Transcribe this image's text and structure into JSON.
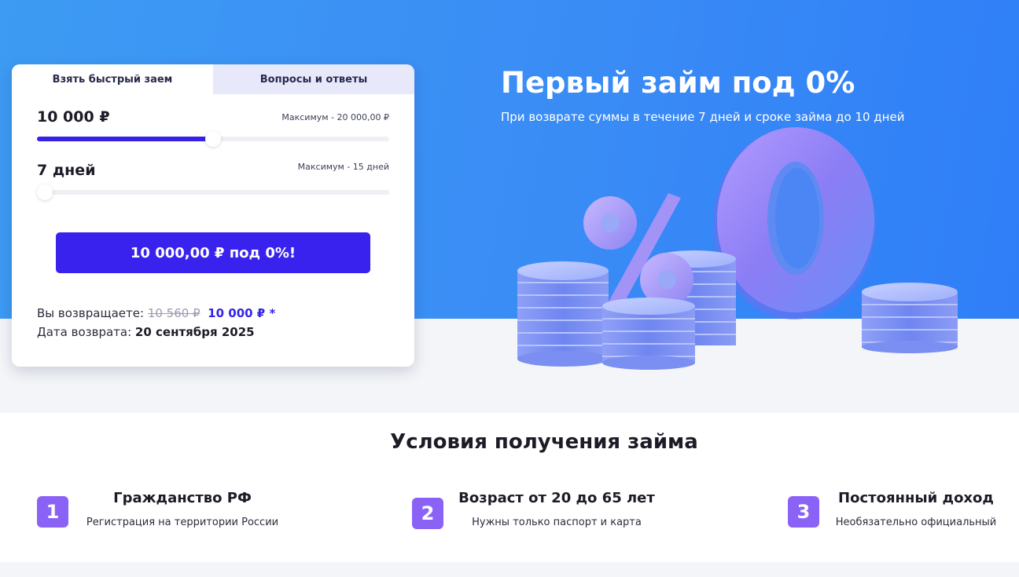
{
  "tabs": {
    "active_label": "Взять быстрый заем",
    "inactive_label": "Вопросы и ответы"
  },
  "amount": {
    "value": "10 000 ₽",
    "max_label": "Максимум - 20 000,00 ₽",
    "slider_fraction": 0.5
  },
  "term": {
    "value": "7 дней",
    "max_label": "Максимум - 15 дней",
    "slider_fraction": 0.0
  },
  "cta_label": "10 000,00 ₽ под 0%!",
  "return": {
    "label": "Вы возвращаете:",
    "old_amount": "10 560 ₽",
    "new_amount": "10 000 ₽ *",
    "date_label": "Дата возврата:",
    "date_value": "20 сентября 2025"
  },
  "hero": {
    "title": "Первый займ под 0%",
    "subtitle": "При возврате суммы в течение 7 дней и сроке займа до 10 дней",
    "illustration_text": {
      "percent": "%",
      "zero": "0"
    }
  },
  "conditions": {
    "title": "Условия получения займа",
    "items": [
      {
        "number": "1",
        "heading": "Гражданство РФ",
        "sub": "Регистрация на территории России"
      },
      {
        "number": "2",
        "heading": "Возраст от 20 до 65 лет",
        "sub": "Нужны только паспорт и карта"
      },
      {
        "number": "3",
        "heading": "Постоянный доход",
        "sub": "Необязательно официальный"
      }
    ]
  },
  "colors": {
    "accent": "#3a22ee",
    "badge": "#8a63f6",
    "hero_blue": "#3a8cf5"
  }
}
